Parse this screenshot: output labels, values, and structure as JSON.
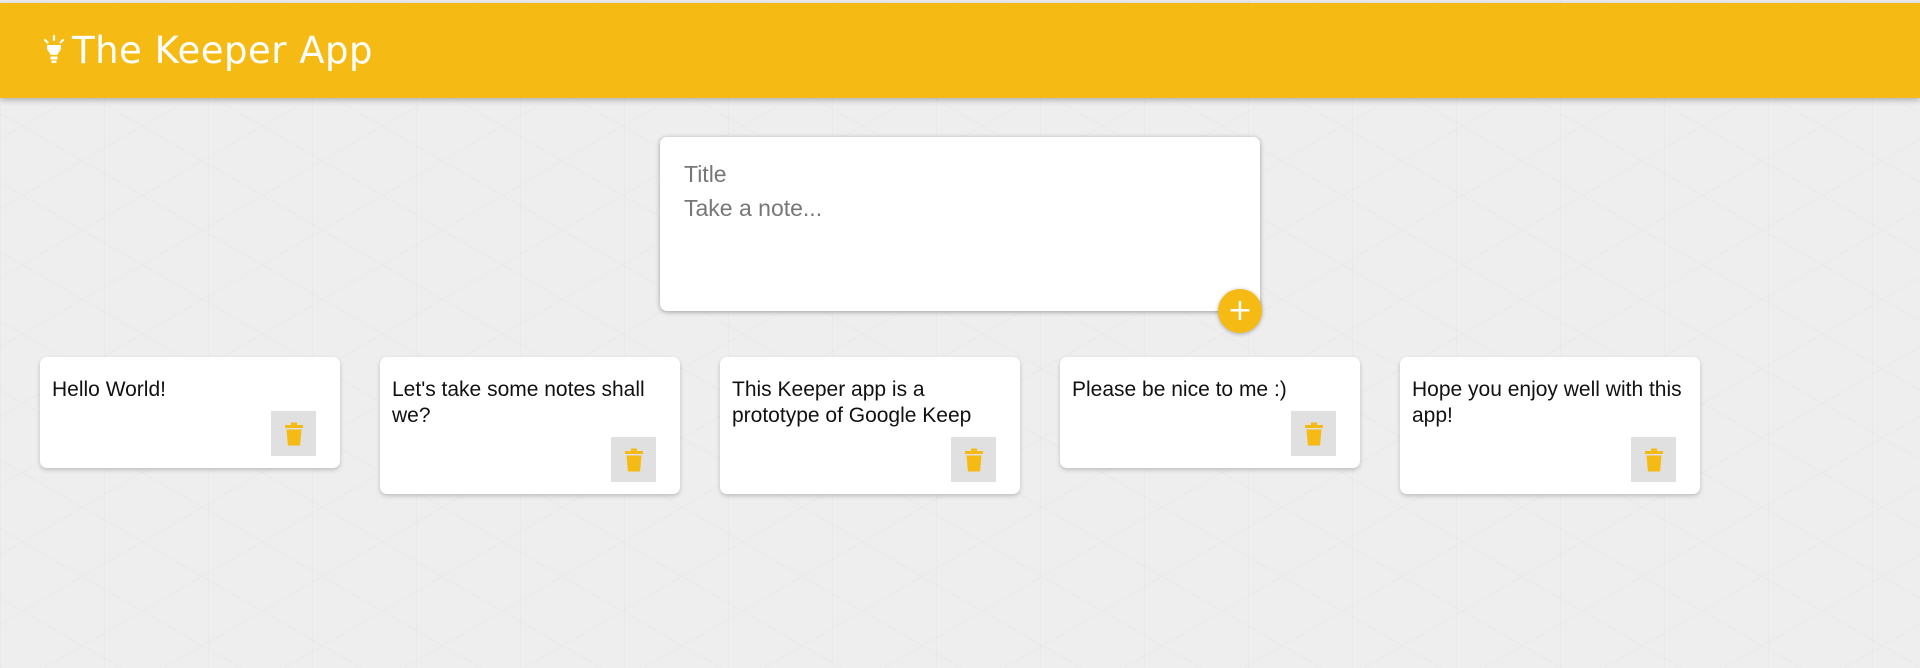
{
  "app": {
    "title": "The Keeper App",
    "logo_icon": "lightbulb-icon",
    "accent_color": "#f5ba13"
  },
  "create_note": {
    "title_placeholder": "Title",
    "content_placeholder": "Take a note...",
    "add_icon": "plus-icon"
  },
  "notes": [
    {
      "content": "Hello World!",
      "delete_icon": "trash-icon"
    },
    {
      "content": "Let's take some notes shall we?",
      "delete_icon": "trash-icon"
    },
    {
      "content": "This Keeper app is a prototype of Google Keep",
      "delete_icon": "trash-icon"
    },
    {
      "content": "Please be nice to me :)",
      "delete_icon": "trash-icon"
    },
    {
      "content": "Hope you enjoy well with this app!",
      "delete_icon": "trash-icon"
    }
  ]
}
